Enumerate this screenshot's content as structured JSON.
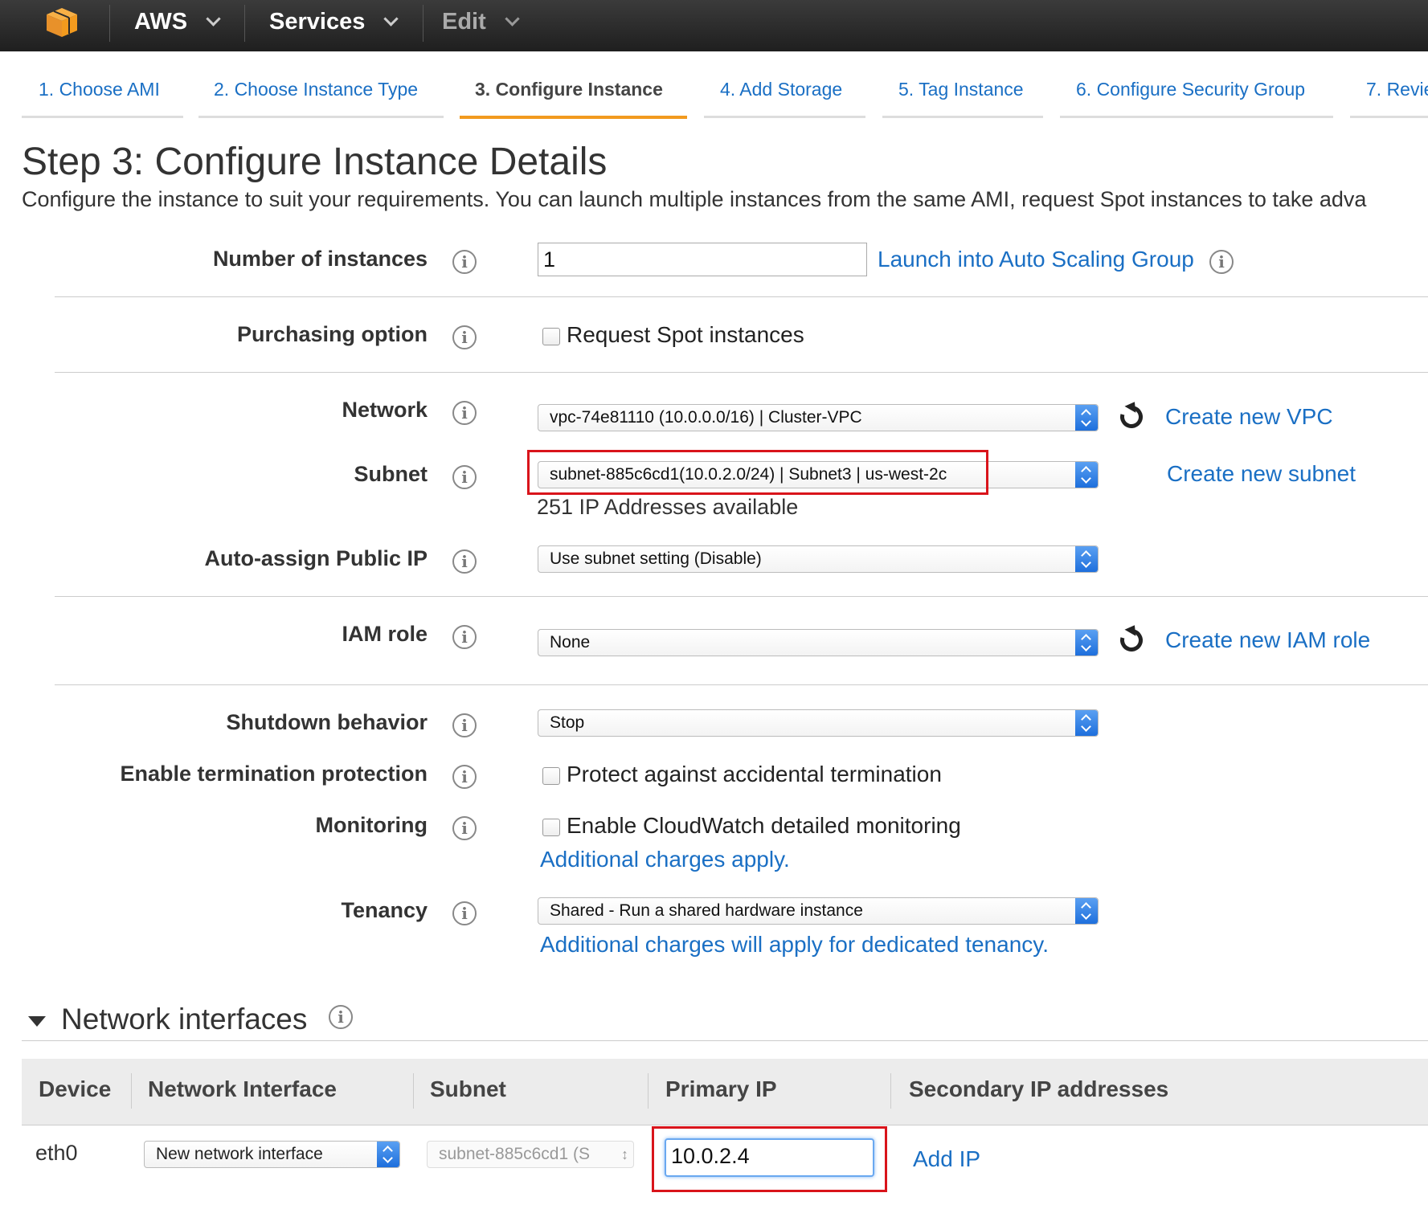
{
  "topnav": {
    "aws_label": "AWS",
    "services_label": "Services",
    "edit_label": "Edit"
  },
  "wizard_tabs": [
    {
      "label": "1. Choose AMI"
    },
    {
      "label": "2. Choose Instance Type"
    },
    {
      "label": "3. Configure Instance",
      "active": true
    },
    {
      "label": "4. Add Storage"
    },
    {
      "label": "5. Tag Instance"
    },
    {
      "label": "6. Configure Security Group"
    },
    {
      "label": "7. Revie"
    }
  ],
  "page": {
    "title": "Step 3: Configure Instance Details",
    "subtitle": "Configure the instance to suit your requirements. You can launch multiple instances from the same AMI, request Spot instances to take adva"
  },
  "form": {
    "number_of_instances": {
      "label": "Number of instances",
      "value": "1",
      "link": "Launch into Auto Scaling Group"
    },
    "purchasing_option": {
      "label": "Purchasing option",
      "checkbox": "Request Spot instances"
    },
    "network": {
      "label": "Network",
      "value": "vpc-74e81110 (10.0.0.0/16) | Cluster-VPC",
      "link": "Create new VPC"
    },
    "subnet": {
      "label": "Subnet",
      "value": "subnet-885c6cd1(10.0.2.0/24) | Subnet3 | us-west-2c",
      "link": "Create new subnet",
      "note": "251 IP Addresses available"
    },
    "auto_assign_ip": {
      "label": "Auto-assign Public IP",
      "value": "Use subnet setting (Disable)"
    },
    "iam_role": {
      "label": "IAM role",
      "value": "None",
      "link": "Create new IAM role"
    },
    "shutdown": {
      "label": "Shutdown behavior",
      "value": "Stop"
    },
    "termination": {
      "label": "Enable termination protection",
      "checkbox": "Protect against accidental termination"
    },
    "monitoring": {
      "label": "Monitoring",
      "checkbox": "Enable CloudWatch detailed monitoring",
      "link": "Additional charges apply."
    },
    "tenancy": {
      "label": "Tenancy",
      "value": "Shared - Run a shared hardware instance",
      "link": "Additional charges will apply for dedicated tenancy."
    }
  },
  "network_interfaces": {
    "title": "Network interfaces",
    "columns": [
      "Device",
      "Network Interface",
      "Subnet",
      "Primary IP",
      "Secondary IP addresses"
    ],
    "row": {
      "device": "eth0",
      "interface": "New network interface",
      "subnet": "subnet-885c6cd1 (S",
      "primary_ip": "10.0.2.4",
      "add_ip": "Add IP"
    }
  },
  "colors": {
    "link": "#1a6fc4",
    "active_tab": "#f29a1e",
    "highlight": "#d9141b"
  }
}
